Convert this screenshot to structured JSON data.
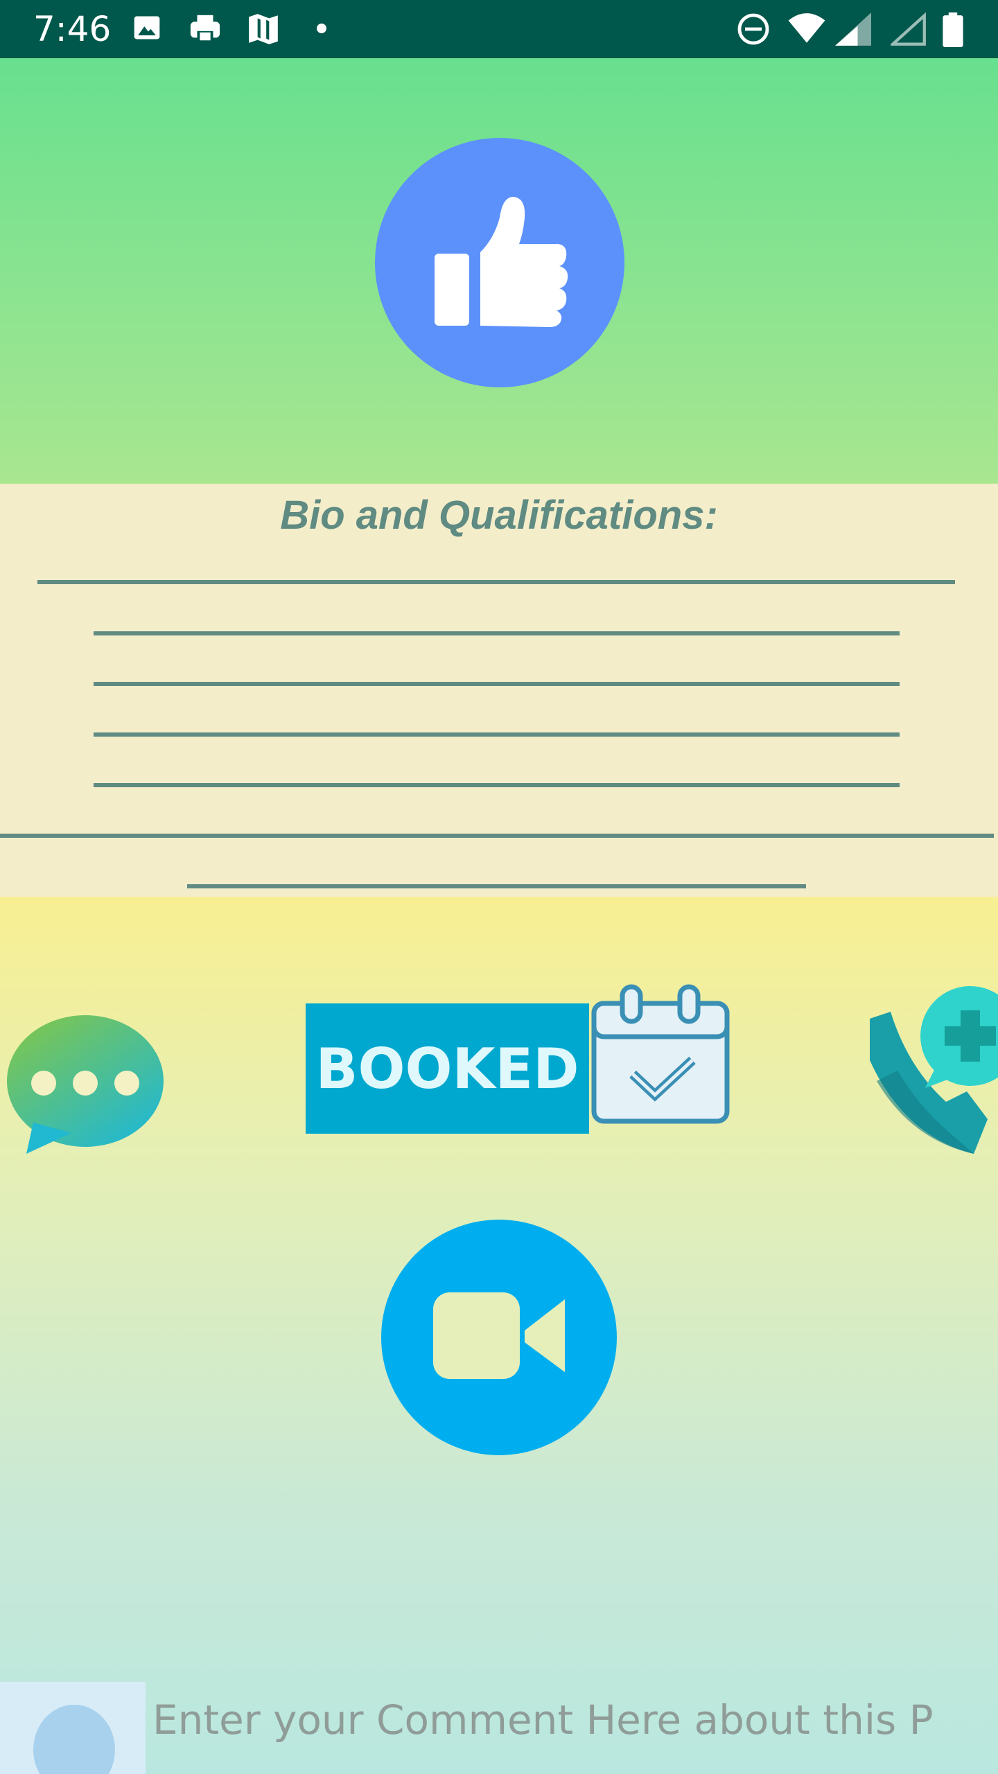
{
  "status_bar": {
    "time": "7:46",
    "left_icons": [
      "image-icon",
      "printer-icon",
      "maps-icon",
      "dot-icon"
    ],
    "right_icons": [
      "do-not-disturb-icon",
      "wifi-icon",
      "signal-icon",
      "signal-empty-icon",
      "battery-icon"
    ]
  },
  "header": {
    "like_icon": "thumbs-up-icon",
    "colors": {
      "top": "#68e08f",
      "bottom": "#a9e690",
      "button": "#5c91fb"
    }
  },
  "bio": {
    "title": "Bio and Qualifications:",
    "background": "#f4edca",
    "line_color": "#5f8b82"
  },
  "actions": {
    "chat_icon": "chat-bubble-icon",
    "booked_label": "BOOKED",
    "calendar_icon": "calendar-check-icon",
    "call_icon": "phone-add-icon",
    "video_icon": "video-camera-icon",
    "colors": {
      "booked": "#00a7cf",
      "video": "#00aeef"
    }
  },
  "comment": {
    "placeholder": "Enter your Comment Here about this P"
  }
}
